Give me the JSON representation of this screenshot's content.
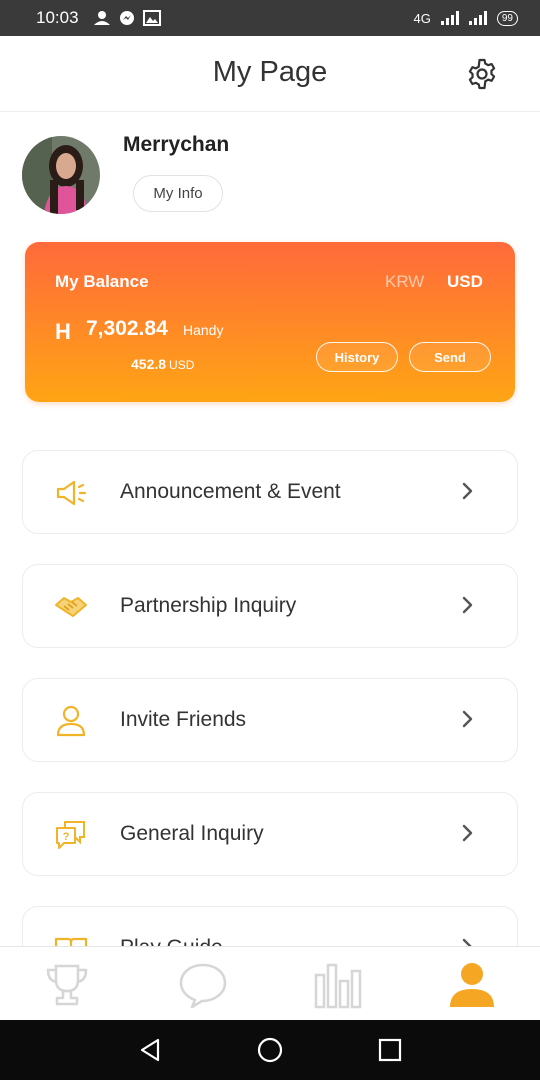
{
  "status": {
    "time": "10:03",
    "network": "4G",
    "battery": "99"
  },
  "header": {
    "title": "My Page",
    "settings_icon": "gear-icon"
  },
  "profile": {
    "username": "Merrychan",
    "my_info_label": "My Info"
  },
  "balance": {
    "label": "My Balance",
    "currency_krw": "KRW",
    "currency_usd": "USD",
    "selected_currency": "USD",
    "token_symbol": "H",
    "amount": "7,302.84",
    "unit": "Handy",
    "usd_amount": "452.8",
    "usd_unit": "USD",
    "history_label": "History",
    "send_label": "Send"
  },
  "menu": [
    {
      "label": "Announcement & Event",
      "icon": "megaphone-icon"
    },
    {
      "label": "Partnership Inquiry",
      "icon": "handshake-icon"
    },
    {
      "label": "Invite Friends",
      "icon": "person-icon"
    },
    {
      "label": "General Inquiry",
      "icon": "question-chat-icon"
    },
    {
      "label": "Play Guide",
      "icon": "book-icon"
    }
  ],
  "bottom_nav": [
    {
      "name": "trophy-icon",
      "active": false
    },
    {
      "name": "chat-bubble-icon",
      "active": false
    },
    {
      "name": "bar-chart-icon",
      "active": false
    },
    {
      "name": "profile-icon",
      "active": true
    }
  ],
  "colors": {
    "accent": "#f5a623",
    "card_top": "#ff6a3a",
    "card_bottom": "#ffa514",
    "inactive_icon": "#d9d9d9"
  }
}
